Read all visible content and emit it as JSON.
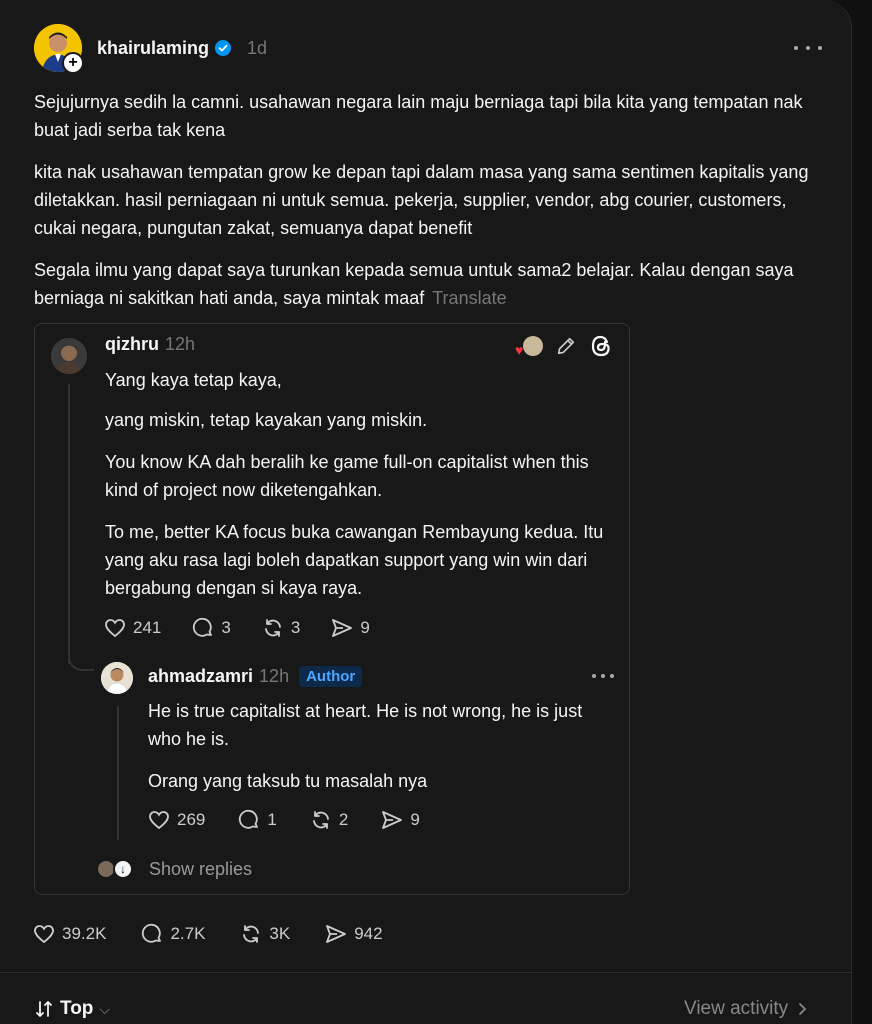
{
  "post": {
    "username": "khairulaming",
    "time": "1d",
    "paragraphs": [
      "Sejujurnya sedih la camni. usahawan negara lain maju berniaga tapi bila kita yang tempatan nak buat jadi serba tak kena",
      "kita nak usahawan tempatan grow ke depan tapi dalam masa yang sama sentimen kapitalis yang diletakkan. hasil perniagaan ni untuk semua. pekerja, supplier, vendor, abg courier, customers, cukai negara, pungutan zakat, semuanya dapat benefit",
      "Segala ilmu yang dapat saya turunkan kepada semua untuk sama2 belajar. Kalau dengan saya berniaga ni sakitkan hati anda, saya mintak maaf"
    ],
    "translate_label": "Translate",
    "stats": {
      "likes": "39.2K",
      "comments": "2.7K",
      "reposts": "3K",
      "shares": "942"
    }
  },
  "quote": {
    "username": "qizhru",
    "time": "12h",
    "paragraphs": [
      "Yang kaya tetap kaya,",
      "yang miskin, tetap kayakan yang miskin.",
      "You know KA dah beralih ke game full-on capitalist when this kind of project now diketengahkan.",
      "To me, better KA focus buka cawangan Rembayung kedua. Itu yang aku rasa lagi boleh dapatkan support yang win win dari bergabung dengan si kaya raya."
    ],
    "stats": {
      "likes": "241",
      "comments": "3",
      "reposts": "3",
      "shares": "9"
    },
    "reply": {
      "username": "ahmadzamri",
      "time": "12h",
      "badge": "Author",
      "paragraphs": [
        "He is true capitalist at heart. He is not wrong, he is just who he is.",
        "Orang yang taksub tu masalah nya"
      ],
      "stats": {
        "likes": "269",
        "comments": "1",
        "reposts": "2",
        "shares": "9"
      }
    },
    "show_replies_label": "Show replies"
  },
  "footer": {
    "sort_label": "Top",
    "view_activity_label": "View activity"
  },
  "colors": {
    "background": "#181818",
    "text": "#f3f5f7",
    "muted": "#777777",
    "like_red": "#ff3040",
    "author_blue": "#4ea4ff",
    "verified_blue": "#0095f6"
  },
  "icons": [
    "heart-icon",
    "comment-icon",
    "repost-icon",
    "share-icon",
    "verified-icon",
    "pencil-icon",
    "threads-logo-icon",
    "more-icon",
    "sort-icon",
    "chevron-down-icon",
    "chevron-right-icon"
  ]
}
